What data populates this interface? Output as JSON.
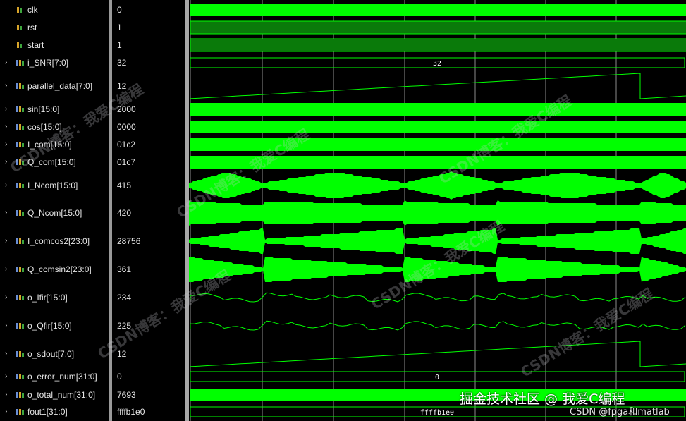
{
  "signals": [
    {
      "name": "clk",
      "value": "0",
      "kind": "bit",
      "expandable": false,
      "bus_label": ""
    },
    {
      "name": "rst",
      "value": "1",
      "kind": "bit",
      "expandable": false,
      "bus_label": ""
    },
    {
      "name": "start",
      "value": "1",
      "kind": "bit",
      "expandable": false,
      "bus_label": ""
    },
    {
      "name": "i_SNR[7:0]",
      "value": "32",
      "kind": "bus",
      "expandable": true,
      "bus_label": "32"
    },
    {
      "name": "parallel_data[7:0]",
      "value": "12",
      "kind": "bus",
      "expandable": true,
      "bus_label": ""
    },
    {
      "name": "sin[15:0]",
      "value": "2000",
      "kind": "bus",
      "expandable": true,
      "bus_label": ""
    },
    {
      "name": "cos[15:0]",
      "value": "0000",
      "kind": "bus",
      "expandable": true,
      "bus_label": ""
    },
    {
      "name": "I_com[15:0]",
      "value": "01c2",
      "kind": "bus",
      "expandable": true,
      "bus_label": ""
    },
    {
      "name": "Q_com[15:0]",
      "value": "01c7",
      "kind": "bus",
      "expandable": true,
      "bus_label": ""
    },
    {
      "name": "I_Ncom[15:0]",
      "value": "415",
      "kind": "bus",
      "expandable": true,
      "bus_label": ""
    },
    {
      "name": "Q_Ncom[15:0]",
      "value": "420",
      "kind": "bus",
      "expandable": true,
      "bus_label": ""
    },
    {
      "name": "I_comcos2[23:0]",
      "value": "28756",
      "kind": "bus",
      "expandable": true,
      "bus_label": ""
    },
    {
      "name": "Q_comsin2[23:0]",
      "value": "361",
      "kind": "bus",
      "expandable": true,
      "bus_label": ""
    },
    {
      "name": "o_Ifir[15:0]",
      "value": "234",
      "kind": "bus",
      "expandable": true,
      "bus_label": ""
    },
    {
      "name": "o_Qfir[15:0]",
      "value": "225",
      "kind": "bus",
      "expandable": true,
      "bus_label": ""
    },
    {
      "name": "o_sdout[7:0]",
      "value": "12",
      "kind": "bus",
      "expandable": true,
      "bus_label": ""
    },
    {
      "name": "o_error_num[31:0]",
      "value": "0",
      "kind": "bus",
      "expandable": true,
      "bus_label": "0"
    },
    {
      "name": "o_total_num[31:0]",
      "value": "7693",
      "kind": "bus",
      "expandable": true,
      "bus_label": ""
    },
    {
      "name": "fout1[31:0]",
      "value": "ffffb1e0",
      "kind": "bus",
      "expandable": true,
      "bus_label": "ffffb1e0"
    }
  ],
  "watermark": {
    "text": "CSDN博客：我爱C编程",
    "footer_brand": "掘金技术社区 @ 我爱C编程",
    "footer_sub": "CSDN @fpga和matlab"
  },
  "colors": {
    "waveform": "#00ff00",
    "waveform_dim": "#0a7a0a",
    "grid": "#ffffff",
    "background": "#000000",
    "text": "#e6e6e6"
  },
  "icons": {
    "bit_signal": "single-bit-signal-icon",
    "bus_signal": "bus-signal-icon",
    "expand": "chevron-right-icon"
  }
}
